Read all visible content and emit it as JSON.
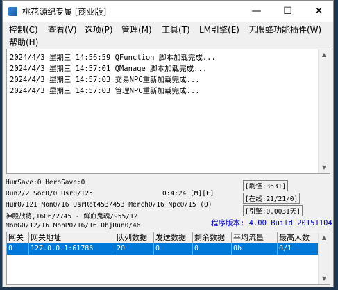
{
  "window": {
    "title": "桃花源纪专属 [商业版]",
    "minimize_glyph": "—",
    "maximize_glyph": "☐",
    "close_glyph": "✕"
  },
  "menu": [
    "控制(C)",
    "查看(V)",
    "选项(P)",
    "管理(M)",
    "工具(T)",
    "LM引擎(E)",
    "无限蜂功能插件(W)",
    "帮助(H)"
  ],
  "log_lines": [
    "2024/4/3 星期三 14:56:59 QFunction 脚本加载完成...",
    "2024/4/3 星期三 14:57:01 QManage 脚本加载完成...",
    "2024/4/3 星期三 14:57:03 交易NPC重新加载完成...",
    "2024/4/3 星期三 14:57:03 管理NPC重新加载完成..."
  ],
  "status": {
    "hum_save": "HumSave:0 HeroSave:0",
    "run": "Run2/2 Soc0/0 Usr0/125",
    "time": "0:4:24 [M][F]",
    "hum": "Hum0/121 Mon0/16 UsrRot453/453 Merch0/16 Npc0/15 (0)",
    "god": "神殿战将,1606/2745 - 鲜血鬼魂/955/12",
    "mon_gen": "MonG0/12/16 MonP0/16/16 ObjRun0/46",
    "refresh": "[刷怪:3631]",
    "online": "[在线:21/21/0]",
    "engine": "[引擎:0.0031天]",
    "version": "程序版本: 4.00 Build 20151104"
  },
  "grid": {
    "columns": [
      "网关",
      "网关地址",
      "队列数据",
      "发送数据",
      "剩余数据",
      "平均流量",
      "最高人数"
    ],
    "rows": [
      [
        "0",
        "127.0.0.1:61786",
        "20",
        "0",
        "0",
        "0b",
        "0/1"
      ]
    ]
  },
  "colors": {
    "selection": "#0078d7",
    "version_text": "#0000cc"
  }
}
